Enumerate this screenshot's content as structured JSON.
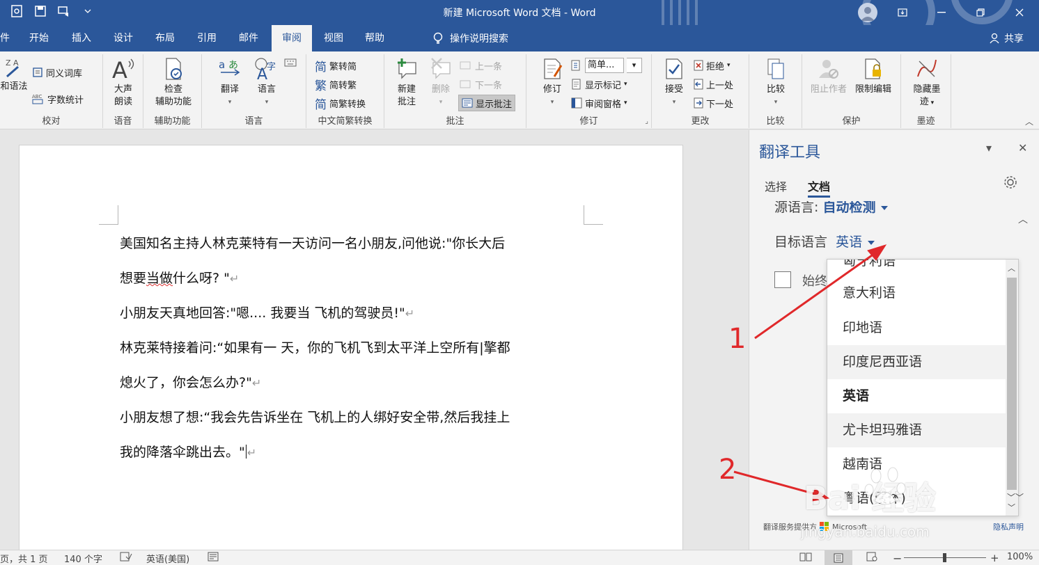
{
  "window": {
    "title": "新建 Microsoft Word 文档  -  Word"
  },
  "tabs": {
    "file_partial": "件",
    "items": [
      "开始",
      "插入",
      "设计",
      "布局",
      "引用",
      "邮件",
      "审阅",
      "视图",
      "帮助"
    ],
    "active": "审阅",
    "tell_me": "操作说明搜索",
    "share": "共享"
  },
  "ribbon": {
    "proofing": {
      "spelling_partial": "和语法",
      "thesaurus": "同义词库",
      "word_count": "字数统计",
      "label": "校对"
    },
    "speech": {
      "read_aloud": [
        "大声",
        "朗读"
      ],
      "label": "语音"
    },
    "accessibility": {
      "check": [
        "检查",
        "辅助功能"
      ],
      "label": "辅助功能"
    },
    "language": {
      "translate": "翻译",
      "language": "语言",
      "label": "语言"
    },
    "chinese": {
      "to_simplified": "繁转简",
      "to_traditional": "简转繁",
      "convert": "简繁转换",
      "label": "中文简繁转换"
    },
    "comments": {
      "new": [
        "新建",
        "批注"
      ],
      "delete": "删除",
      "previous": "上一条",
      "next": "下一条",
      "show": "显示批注",
      "label": "批注"
    },
    "tracking": {
      "track_changes": "修订",
      "markup_select": "简单...",
      "show_markup": "显示标记",
      "reviewing_pane": "审阅窗格",
      "label": "修订"
    },
    "changes": {
      "accept": "接受",
      "reject": "拒绝",
      "previous": "上一处",
      "next": "下一处",
      "label": "更改"
    },
    "compare": {
      "compare": "比较",
      "label": "比较"
    },
    "protect": {
      "block_authors": "阻止作者",
      "restrict": "限制编辑",
      "label": "保护"
    },
    "ink": {
      "hide_ink": [
        "隐藏墨",
        "迹"
      ],
      "label": "墨迹"
    }
  },
  "document": {
    "lines": [
      [
        "美国知名主持人林克莱特有一天访问一名小朋友,问他说:\"你长大后"
      ],
      [
        "想要",
        "当做",
        "什么呀? \""
      ],
      [
        "小朋友天真地回答:\"嗯....  我要当  飞机的驾驶员!\""
      ],
      [
        "林克莱特接着问:“如果有一  天，你的飞机飞到太平洋上空所有|擎都"
      ],
      [
        "熄火了，你会怎么办?\""
      ],
      [
        "小朋友想了想:“我会先告诉坐在  飞机上的人绑好安全带,然后我挂上"
      ],
      [
        "我的降落伞跳出去。\""
      ]
    ]
  },
  "pane": {
    "title": "翻译工具",
    "tabs": [
      "选择",
      "文档"
    ],
    "active_tab": "文档",
    "source_label": "源语言:",
    "source_value": "自动检测",
    "target_label": "目标语言",
    "target_value": "英语",
    "always_partial": "始终",
    "provider": "翻译服务提供方",
    "provider_brand": "Microsoft",
    "privacy": "隐私声明"
  },
  "dropdown": {
    "items": [
      "匈牙利语",
      "意大利语",
      "印地语",
      "印度尼西亚语",
      "英语",
      "尤卡坦玛雅语",
      "越南语",
      "粤语(繁体)"
    ],
    "selected": "英语"
  },
  "annotations": {
    "one": "1",
    "two": "2"
  },
  "watermark": {
    "brand": "Bai 经验",
    "url": "jingyan.baidu.com"
  },
  "status": {
    "page": "页，共 1 页",
    "words": "140 个字",
    "language": "英语(美国)",
    "zoom": "100%"
  },
  "colors": {
    "accent": "#2b579a",
    "annotation": "#e0282a",
    "ribbon_bg": "#f3f3f3"
  }
}
